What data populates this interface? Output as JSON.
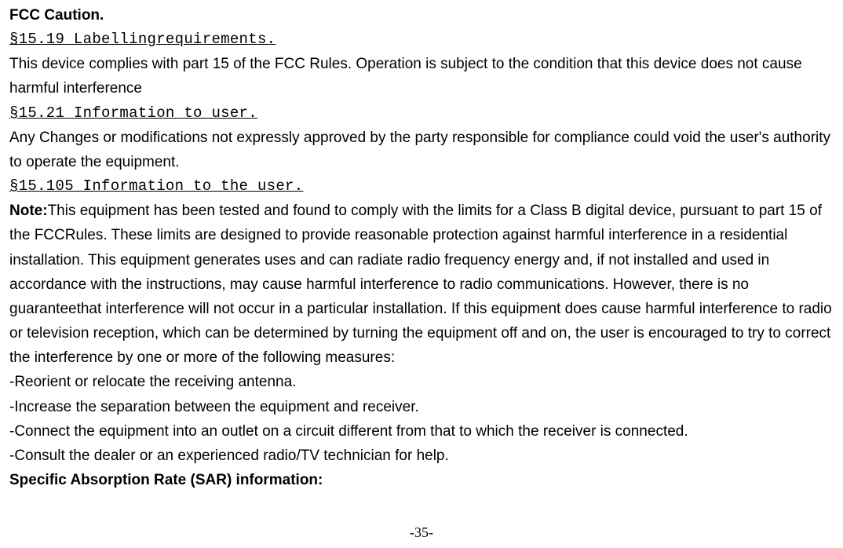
{
  "doc": {
    "heading_fcc": "FCC Caution.",
    "section1_ref": "§15.19 Labellingrequirements.",
    "section1_body": "This device complies with part 15 of the FCC Rules. Operation is subject to the condition that this device does not cause harmful interference",
    "section2_ref": "§15.21 Information to user.",
    "section2_body": "Any Changes or modifications not expressly approved by the party responsible for compliance could void the user's authority to operate the equipment.",
    "section3_ref": "§15.105 Information to the user.",
    "note_prefix": "Note:",
    "note_body": "This equipment has been tested and found to comply with the limits for a Class B digital device, pursuant to part 15 of the FCCRules. These limits are designed to provide reasonable protection against harmful interference in a residential installation. This equipment generates uses and can radiate radio frequency energy and, if not installed and used in accordance with the instructions, may cause harmful interference to radio communications. However, there is no guaranteethat interference will not occur in a particular installation. If this equipment does cause harmful interference to radio or television reception, which can be determined by turning the equipment off and on, the user is encouraged to try to correct the interference by one or more of the following measures:",
    "bullet1": "-Reorient or relocate the receiving antenna.",
    "bullet2": "-Increase the separation between the equipment and receiver.",
    "bullet3": "-Connect the equipment into an outlet on a circuit different from that to which the receiver is connected.",
    "bullet4": "-Consult the dealer or an experienced radio/TV technician for help.",
    "sar_heading": "Specific Absorption Rate (SAR) information:",
    "page_number": "-35-"
  }
}
